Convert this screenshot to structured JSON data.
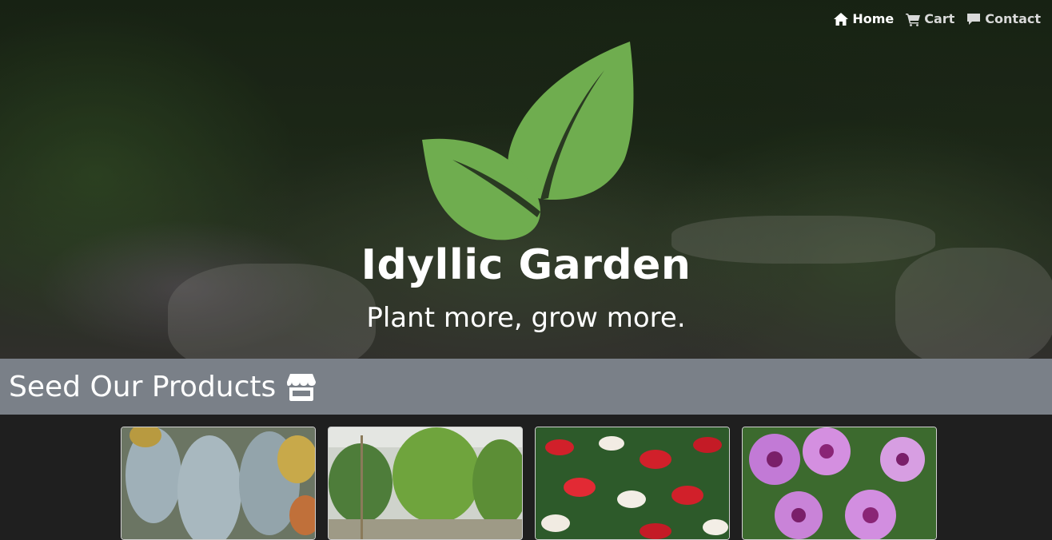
{
  "nav": {
    "items": [
      {
        "label": "Home",
        "icon": "home-icon",
        "active": true
      },
      {
        "label": "Cart",
        "icon": "cart-icon",
        "active": false
      },
      {
        "label": "Contact",
        "icon": "chat-icon",
        "active": false
      }
    ]
  },
  "hero": {
    "logo": "leaf-logo-icon",
    "title": "Idyllic Garden",
    "subtitle": "Plant more, grow more.",
    "logo_color": "#6fad4f"
  },
  "section": {
    "title": "Seed Our Products",
    "icon": "store-icon",
    "bar_color": "#7a8088"
  },
  "products": [
    {
      "image": "succulent plants"
    },
    {
      "image": "greenhouse fiddle leaf fig"
    },
    {
      "image": "red and white anthurium flowers"
    },
    {
      "image": "purple geranium flowers"
    }
  ]
}
